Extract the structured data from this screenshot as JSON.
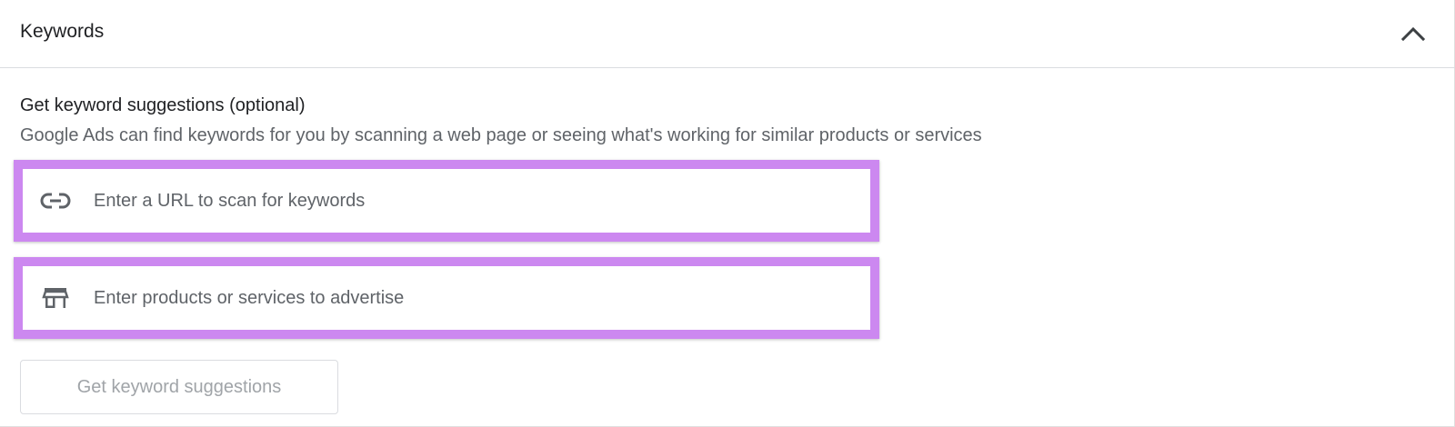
{
  "header": {
    "title": "Keywords",
    "collapse_icon": "chevron-up-icon"
  },
  "section": {
    "title": "Get keyword suggestions (optional)",
    "description": "Google Ads can find keywords for you by scanning a web page or seeing what's working for similar products or services"
  },
  "url_input": {
    "icon": "link-icon",
    "placeholder": "Enter a URL to scan for keywords",
    "value": ""
  },
  "products_input": {
    "icon": "store-icon",
    "placeholder": "Enter products or services to advertise",
    "value": ""
  },
  "suggest_button": {
    "label": "Get keyword suggestions",
    "state": "disabled"
  },
  "colors": {
    "highlight": "#cc88f0",
    "text_primary": "#202124",
    "text_secondary": "#5f6368",
    "button_disabled_text": "#a0a4a8",
    "divider": "#dadce0"
  }
}
